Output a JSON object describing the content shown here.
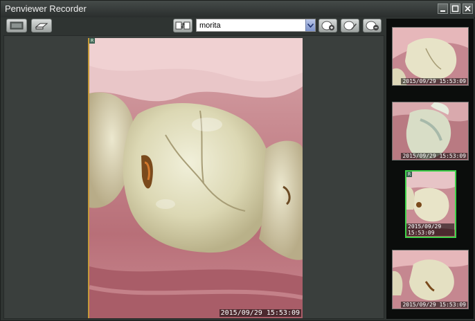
{
  "window": {
    "title": "Penviewer Recorder"
  },
  "window_controls": [
    "minimize",
    "maximize",
    "close"
  ],
  "toolbar": {
    "patient_name": "morita"
  },
  "icons": {
    "monitor": "monitor-icon",
    "capture": "capture-icon",
    "patient_swap": "patient-swap-icon",
    "add_patient": "add-patient-icon",
    "edit_patient": "edit-patient-icon",
    "remove_patient": "remove-patient-icon"
  },
  "main_image": {
    "position_label": "R",
    "timestamp": "2015/09/29 15:53:09"
  },
  "thumbnails": [
    {
      "label": "",
      "timestamp": "2015/09/29 15:53:09",
      "selected": false
    },
    {
      "label": "",
      "timestamp": "2015/09/29 15:53:09",
      "selected": false
    },
    {
      "label": "R",
      "timestamp": "2015/09/29 15:53:09",
      "selected": true
    },
    {
      "label": "",
      "timestamp": "2015/09/29 15:53:09",
      "selected": false
    }
  ]
}
